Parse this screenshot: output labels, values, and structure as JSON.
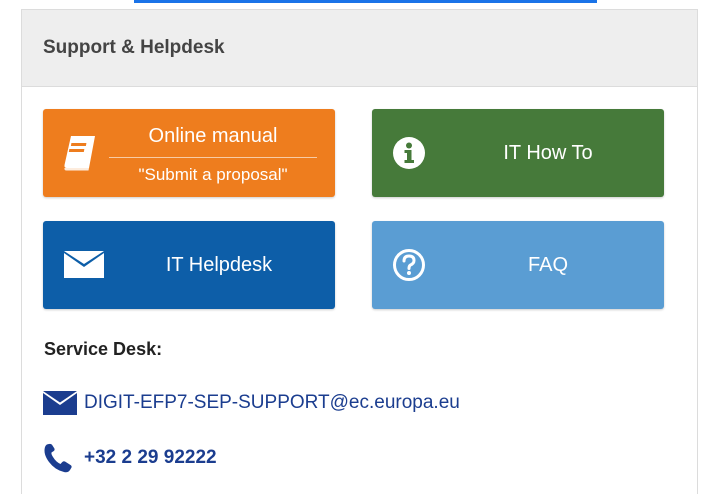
{
  "panel": {
    "title": "Support & Helpdesk"
  },
  "tiles": {
    "manual": {
      "title": "Online manual",
      "subtitle": "\"Submit a proposal\"",
      "icon": "book-icon",
      "color": "#ee7d1e"
    },
    "howto": {
      "label": "IT How To",
      "icon": "info-icon",
      "color": "#467a3a"
    },
    "helpdesk": {
      "label": "IT Helpdesk",
      "icon": "envelope-icon",
      "color": "#0d5ea8"
    },
    "faq": {
      "label": "FAQ",
      "icon": "question-icon",
      "color": "#5a9dd3"
    }
  },
  "service_desk": {
    "title": "Service Desk:",
    "email": "DIGIT-EFP7-SEP-SUPPORT@ec.europa.eu",
    "phone": "+32 2 29 92222",
    "accent_color": "#1b3d8f"
  }
}
